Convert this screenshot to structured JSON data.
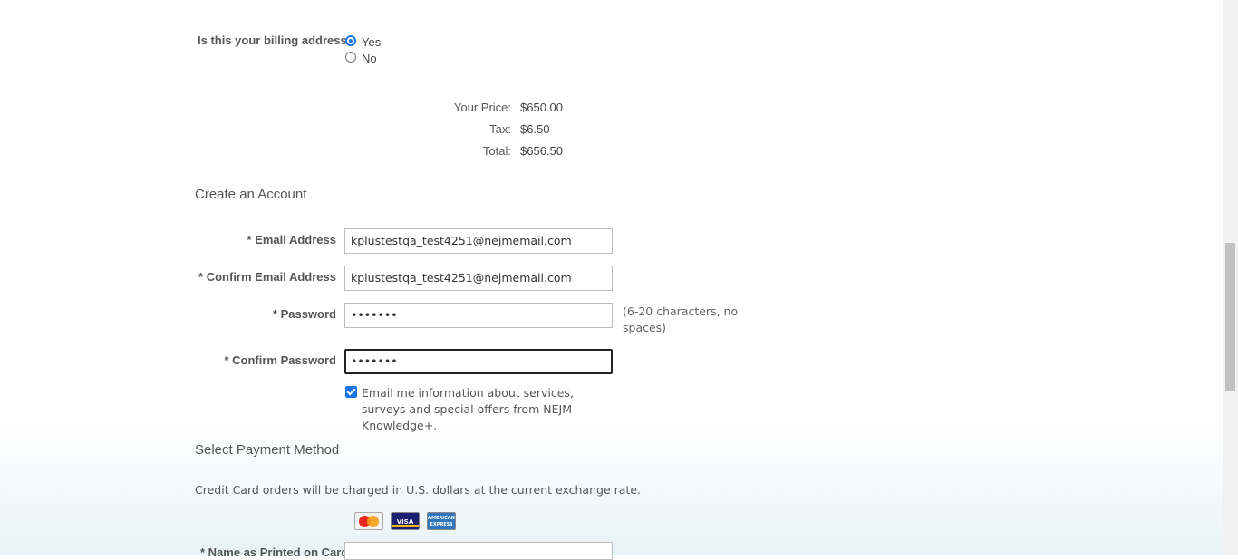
{
  "billing": {
    "question": "Is this your billing address?",
    "options": [
      {
        "label": "Yes",
        "checked": true
      },
      {
        "label": "No",
        "checked": false
      }
    ]
  },
  "pricing": {
    "price_label": "Your Price:",
    "price_value": "$650.00",
    "tax_label": "Tax:",
    "tax_value": "$6.50",
    "total_label": "Total:",
    "total_value": "$656.50"
  },
  "account": {
    "title": "Create an Account",
    "email_label": "* Email Address",
    "email_value": "kplustestqa_test4251@nejmemail.com",
    "confirm_email_label": "* Confirm Email Address",
    "confirm_email_value": "kplustestqa_test4251@nejmemail.com",
    "password_label": "* Password",
    "password_value": "•••••••",
    "password_hint": "(6-20 characters, no spaces)",
    "confirm_password_label": "* Confirm Password",
    "confirm_password_value": "•••••••",
    "optin_checked": true,
    "optin_text": "Email me information about services, surveys and special offers from NEJM Knowledge+."
  },
  "payment": {
    "title": "Select Payment Method",
    "note": "Credit Card orders will be charged in U.S. dollars at the current exchange rate.",
    "cards": [
      {
        "name": "MasterCard",
        "icon": "mastercard-icon",
        "text": "MasterCard"
      },
      {
        "name": "Visa",
        "icon": "visa-icon",
        "text": "VISA"
      },
      {
        "name": "American Express",
        "icon": "amex-icon",
        "text": "AMERICAN EXPRESS"
      }
    ],
    "name_on_card_label": "* Name as Printed on Card",
    "name_on_card_value": ""
  },
  "colors": {
    "accent": "#1a73e8",
    "page_background": "#ffffff",
    "bottom_tint": "#e8f3f6"
  }
}
